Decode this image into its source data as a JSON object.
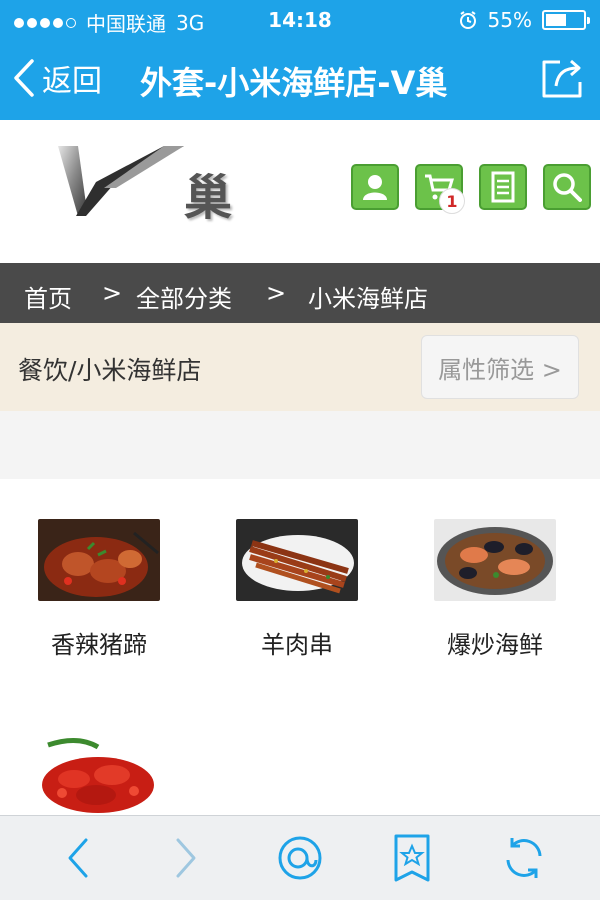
{
  "status_bar": {
    "carrier": "中国联通",
    "network": "3G",
    "time": "14:18",
    "battery": "55%",
    "battery_level": 0.55
  },
  "nav": {
    "back_label": "返回",
    "title": "外套-小米海鲜店-V巢"
  },
  "header": {
    "logo_char": "巢",
    "cart_count": "1",
    "icons": [
      "user-icon",
      "cart-icon",
      "orders-icon",
      "search-icon"
    ]
  },
  "breadcrumb": {
    "home": "首页",
    "sep1": ">",
    "all": "全部分类",
    "sep2": ">",
    "current": "小米海鲜店"
  },
  "category": {
    "path": "餐饮/小米海鲜店",
    "filter_label": "属性筛选 >"
  },
  "products": [
    {
      "name": "香辣猪蹄"
    },
    {
      "name": "羊肉串"
    },
    {
      "name": "爆炒海鲜"
    },
    {
      "name": ""
    }
  ],
  "bottom_bar": {
    "icons": [
      "back-icon",
      "forward-icon",
      "home-icon",
      "bookmark-icon",
      "refresh-icon"
    ]
  },
  "colors": {
    "topbar": "#1ea3e8",
    "icon_green": "#6cc24a",
    "breadcrumb_bg": "#4a4a4a",
    "category_bg": "#f4ede0"
  }
}
